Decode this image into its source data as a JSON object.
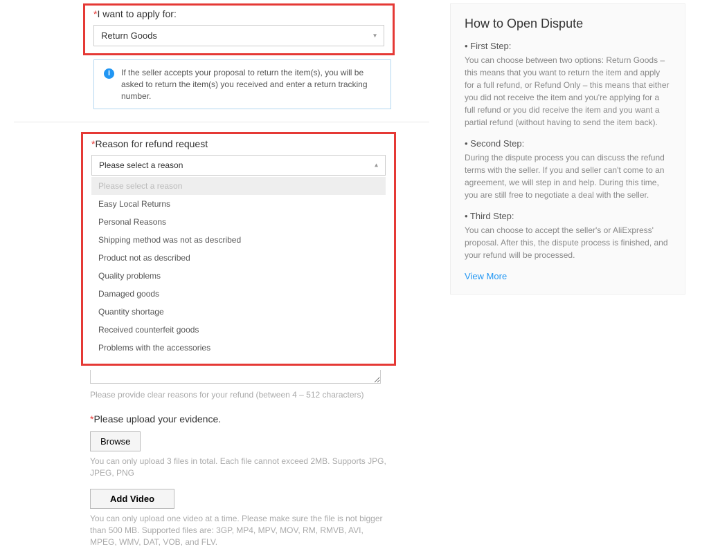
{
  "applyFor": {
    "label": "I want to apply for:",
    "value": "Return Goods"
  },
  "info": "If the seller accepts your proposal to return the item(s), you will be asked to return the item(s) you received and enter a return tracking number.",
  "reason": {
    "label": "Reason for refund request",
    "selected": "Please select a reason",
    "options": [
      "Please select a reason",
      "Easy Local Returns",
      "Personal Reasons",
      "Shipping method was not as described",
      "Product not as described",
      "Quality problems",
      "Damaged goods",
      "Quantity shortage",
      "Received counterfeit goods",
      "Problems with the accessories"
    ]
  },
  "textareaHint": "Please provide clear reasons for your refund (between 4 – 512 characters)",
  "upload": {
    "label": "Please upload your evidence.",
    "browse": "Browse",
    "browseHint": "You can only upload 3 files in total. Each file cannot exceed 2MB. Supports JPG, JPEG, PNG",
    "addVideo": "Add Video",
    "videoHint": "You can only upload one video at a time. Please make sure the file is not bigger than 500 MB. Supported files are: 3GP, MP4, MPV, MOV, RM, RMVB, AVI, MPEG, WMV, DAT, VOB, and FLV."
  },
  "sidebar": {
    "title": "How to Open Dispute",
    "steps": [
      {
        "label": "• First Step:",
        "text": "You can choose between two options: Return Goods – this means that you want to return the item and apply for a full refund, or Refund Only – this means that either you did not receive the item and you're applying for a full refund or you did receive the item and you want a partial refund (without having to send the item back)."
      },
      {
        "label": "• Second Step:",
        "text": "During the dispute process you can discuss the refund terms with the seller. If you and seller can't come to an agreement, we will step in and help. During this time, you are still free to negotiate a deal with the seller."
      },
      {
        "label": "• Third Step:",
        "text": "You can choose to accept the seller's or AliExpress' proposal. After this, the dispute process is finished, and your refund will be processed."
      }
    ],
    "viewMore": "View More"
  }
}
